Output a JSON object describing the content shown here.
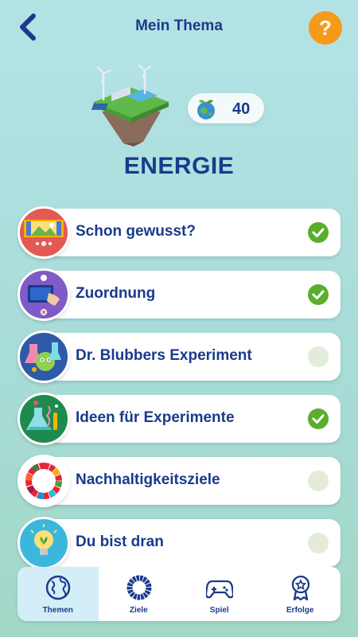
{
  "header": {
    "title": "Mein Thema",
    "help_label": "?"
  },
  "topic": {
    "name": "ENERGIE",
    "points": "40"
  },
  "items": [
    {
      "label": "Schon gewusst?",
      "completed": true,
      "icon": "picture-icon",
      "color": "#e35a55"
    },
    {
      "label": "Zuordnung",
      "completed": true,
      "icon": "drag-hand-icon",
      "color": "#7e5bc6"
    },
    {
      "label": "Dr. Blubbers Experiment",
      "completed": false,
      "icon": "experiment-icon",
      "color": "#2e5aa8"
    },
    {
      "label": "Ideen für Experimente",
      "completed": true,
      "icon": "flask-icon",
      "color": "#1f8a4f"
    },
    {
      "label": "Nachhaltigkeitsziele",
      "completed": false,
      "icon": "sdg-wheel-icon",
      "color": "#ffffff"
    },
    {
      "label": "Du bist dran",
      "completed": false,
      "icon": "lightbulb-icon",
      "color": "#3bb7dd"
    }
  ],
  "tabs": [
    {
      "label": "Themen",
      "icon": "globe-icon",
      "active": true
    },
    {
      "label": "Ziele",
      "icon": "sdg-ring-icon",
      "active": false
    },
    {
      "label": "Spiel",
      "icon": "gamepad-icon",
      "active": false
    },
    {
      "label": "Erfolge",
      "icon": "badge-icon",
      "active": false
    }
  ],
  "colors": {
    "primary": "#1b3a8c",
    "check": "#5cad2e",
    "help": "#f59a1b"
  }
}
